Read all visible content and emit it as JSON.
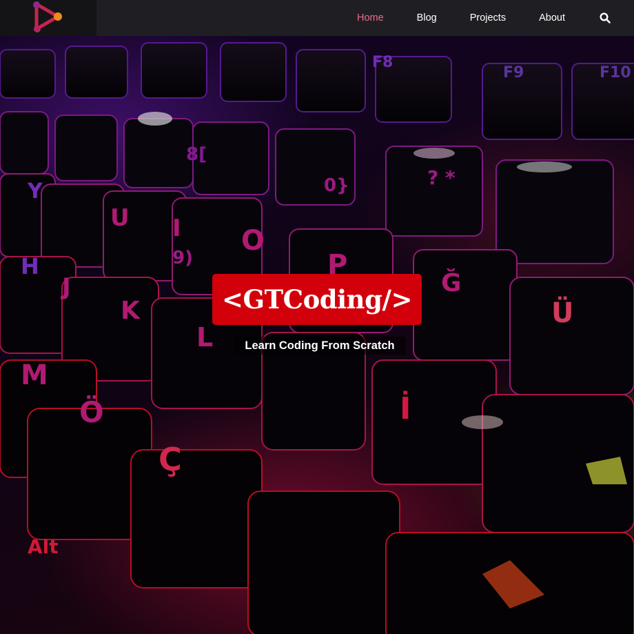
{
  "nav": {
    "logo_icon": "play-triangle-logo-icon",
    "items": [
      {
        "label": "Home",
        "active": true
      },
      {
        "label": "Blog",
        "active": false
      },
      {
        "label": "Projects",
        "active": false
      },
      {
        "label": "About",
        "active": false
      }
    ],
    "search_icon": "search-icon",
    "active_color": "#ef6a8a"
  },
  "hero": {
    "title": "<GTCoding/>",
    "subtitle": "Learn Coding From Scratch",
    "badge_color": "#d2000b",
    "background_icon": "backlit-keyboard-photo"
  }
}
